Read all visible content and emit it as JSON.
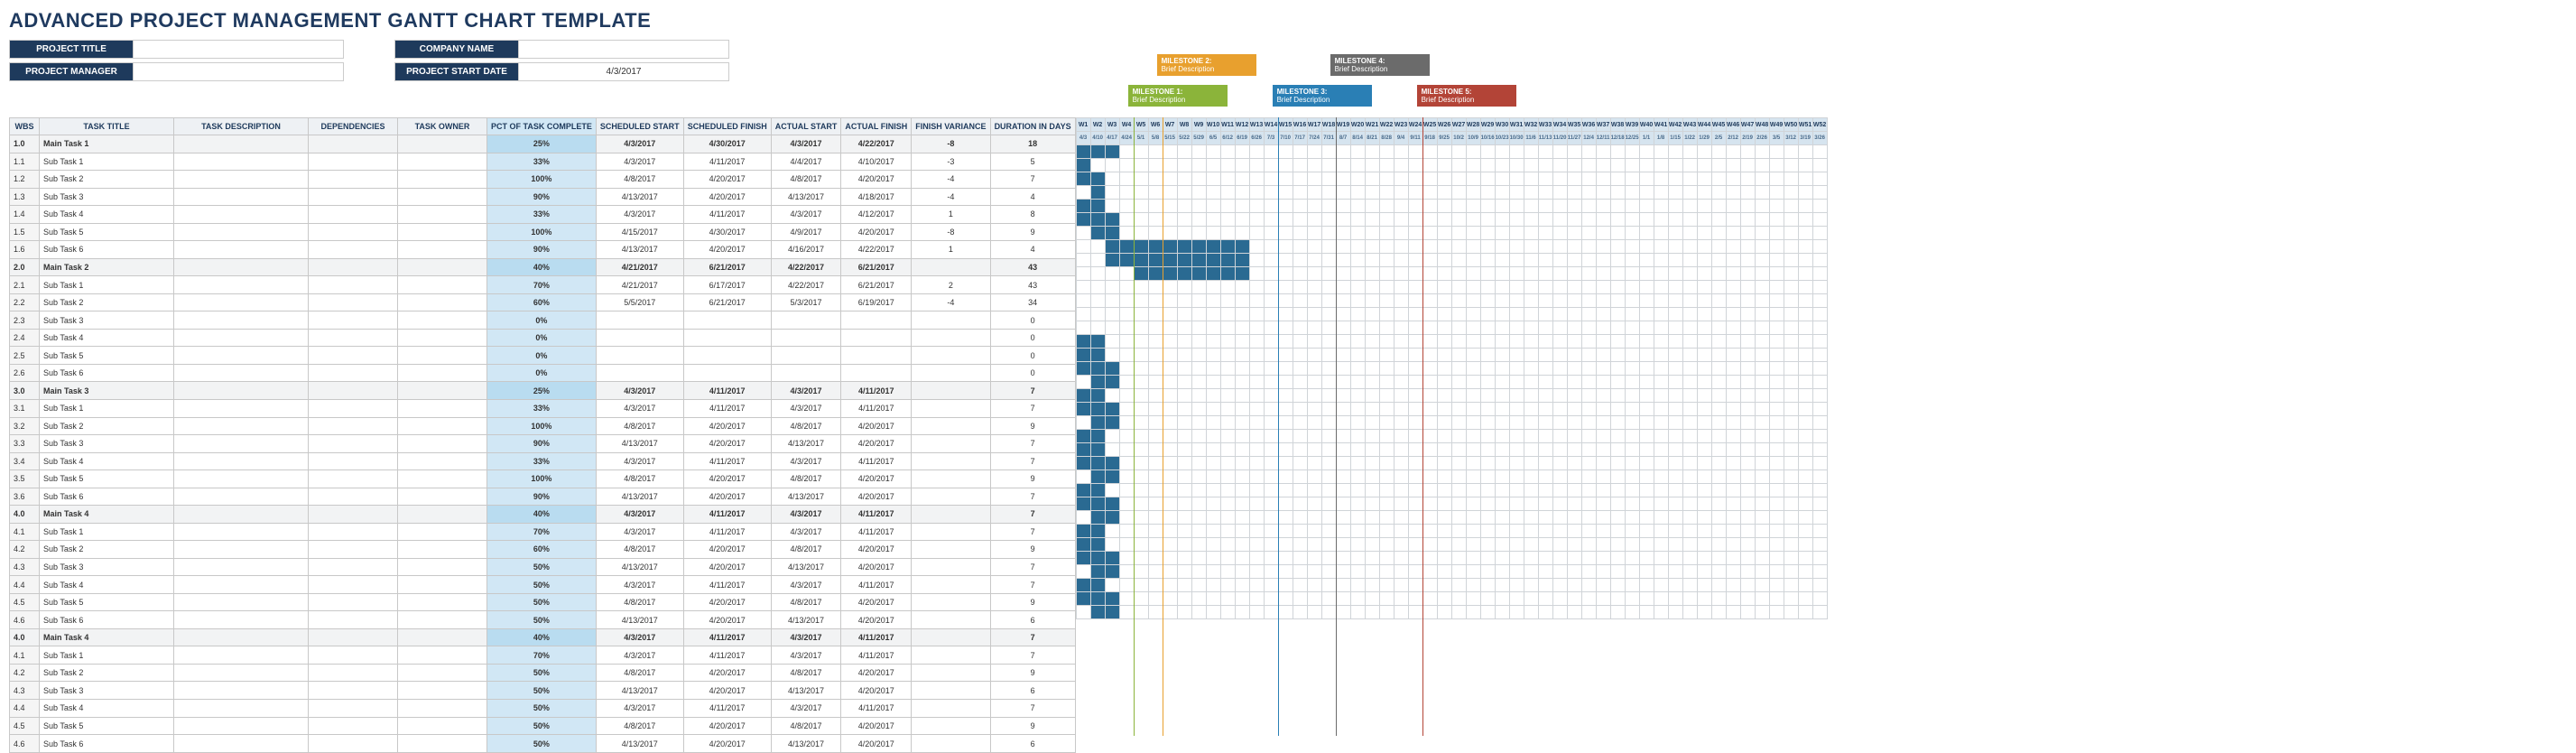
{
  "title": "ADVANCED PROJECT MANAGEMENT GANTT CHART TEMPLATE",
  "fields": {
    "projectTitle": {
      "label": "PROJECT TITLE",
      "value": ""
    },
    "projectManager": {
      "label": "PROJECT MANAGER",
      "value": ""
    },
    "companyName": {
      "label": "COMPANY NAME",
      "value": ""
    },
    "projectStartDate": {
      "label": "PROJECT START DATE",
      "value": "4/3/2017"
    }
  },
  "columns": {
    "wbs": "WBS",
    "taskTitle": "TASK TITLE",
    "taskDesc": "TASK DESCRIPTION",
    "deps": "DEPENDENCIES",
    "owner": "TASK OWNER",
    "pct": "PCT OF TASK COMPLETE",
    "schStart": "SCHEDULED START",
    "schFinish": "SCHEDULED FINISH",
    "actStart": "ACTUAL START",
    "actFinish": "ACTUAL FINISH",
    "variance": "FINISH VARIANCE",
    "duration": "DURATION IN DAYS"
  },
  "milestones": [
    {
      "id": 1,
      "title": "MILESTONE 1:",
      "sub": "Brief Description",
      "week": 5,
      "cls": "ms1"
    },
    {
      "id": 2,
      "title": "MILESTONE 2:",
      "sub": "Brief Description",
      "week": 7,
      "cls": "ms2",
      "offset": -34
    },
    {
      "id": 3,
      "title": "MILESTONE 3:",
      "sub": "Brief Description",
      "week": 15,
      "cls": "ms3"
    },
    {
      "id": 4,
      "title": "MILESTONE 4:",
      "sub": "Brief Description",
      "week": 19,
      "cls": "ms4",
      "offset": -34
    },
    {
      "id": 5,
      "title": "MILESTONE 5:",
      "sub": "Brief Description",
      "week": 25,
      "cls": "ms5"
    }
  ],
  "weeks": [
    "4/3",
    "4/10",
    "4/17",
    "4/24",
    "5/1",
    "5/8",
    "5/15",
    "5/22",
    "5/29",
    "6/5",
    "6/12",
    "6/19",
    "6/26",
    "7/3",
    "7/10",
    "7/17",
    "7/24",
    "7/31",
    "8/7",
    "8/14",
    "8/21",
    "8/28",
    "9/4",
    "9/11",
    "9/18",
    "9/25",
    "10/2",
    "10/9",
    "10/16",
    "10/23",
    "10/30",
    "11/6",
    "11/13",
    "11/20",
    "11/27",
    "12/4",
    "12/11",
    "12/18",
    "12/25",
    "1/1",
    "1/8",
    "1/15",
    "1/22",
    "1/29",
    "2/5",
    "2/12",
    "2/19",
    "2/26",
    "3/5",
    "3/12",
    "3/19",
    "3/26"
  ],
  "rows": [
    {
      "wbs": "1.0",
      "title": "Main Task 1",
      "main": true,
      "pct": "25%",
      "ss": "4/3/2017",
      "sf": "4/30/2017",
      "as": "4/3/2017",
      "af": "4/22/2017",
      "var": "-8",
      "dur": "18",
      "bar": [
        1,
        3
      ]
    },
    {
      "wbs": "1.1",
      "title": "Sub Task 1",
      "pct": "33%",
      "ss": "4/3/2017",
      "sf": "4/11/2017",
      "as": "4/4/2017",
      "af": "4/10/2017",
      "var": "-3",
      "dur": "5",
      "bar": [
        1,
        1
      ]
    },
    {
      "wbs": "1.2",
      "title": "Sub Task 2",
      "pct": "100%",
      "ss": "4/8/2017",
      "sf": "4/20/2017",
      "as": "4/8/2017",
      "af": "4/20/2017",
      "var": "-4",
      "dur": "7",
      "bar": [
        1,
        2
      ]
    },
    {
      "wbs": "1.3",
      "title": "Sub Task 3",
      "pct": "90%",
      "ss": "4/13/2017",
      "sf": "4/20/2017",
      "as": "4/13/2017",
      "af": "4/18/2017",
      "var": "-4",
      "dur": "4",
      "bar": [
        2,
        2
      ]
    },
    {
      "wbs": "1.4",
      "title": "Sub Task 4",
      "pct": "33%",
      "ss": "4/3/2017",
      "sf": "4/11/2017",
      "as": "4/3/2017",
      "af": "4/12/2017",
      "var": "1",
      "dur": "8",
      "bar": [
        1,
        2
      ]
    },
    {
      "wbs": "1.5",
      "title": "Sub Task 5",
      "pct": "100%",
      "ss": "4/15/2017",
      "sf": "4/30/2017",
      "as": "4/9/2017",
      "af": "4/20/2017",
      "var": "-8",
      "dur": "9",
      "bar": [
        1,
        3
      ]
    },
    {
      "wbs": "1.6",
      "title": "Sub Task 6",
      "pct": "90%",
      "ss": "4/13/2017",
      "sf": "4/20/2017",
      "as": "4/16/2017",
      "af": "4/22/2017",
      "var": "1",
      "dur": "4",
      "bar": [
        2,
        3
      ]
    },
    {
      "wbs": "2.0",
      "title": "Main Task 2",
      "main": true,
      "pct": "40%",
      "ss": "4/21/2017",
      "sf": "6/21/2017",
      "as": "4/22/2017",
      "af": "6/21/2017",
      "var": "",
      "dur": "43",
      "bar": [
        3,
        12
      ]
    },
    {
      "wbs": "2.1",
      "title": "Sub Task 1",
      "pct": "70%",
      "ss": "4/21/2017",
      "sf": "6/17/2017",
      "as": "4/22/2017",
      "af": "6/21/2017",
      "var": "2",
      "dur": "43",
      "bar": [
        3,
        12
      ]
    },
    {
      "wbs": "2.2",
      "title": "Sub Task 2",
      "pct": "60%",
      "ss": "5/5/2017",
      "sf": "6/21/2017",
      "as": "5/3/2017",
      "af": "6/19/2017",
      "var": "-4",
      "dur": "34",
      "bar": [
        5,
        12
      ]
    },
    {
      "wbs": "2.3",
      "title": "Sub Task 3",
      "pct": "0%",
      "ss": "",
      "sf": "",
      "as": "",
      "af": "",
      "var": "",
      "dur": "0",
      "bar": null
    },
    {
      "wbs": "2.4",
      "title": "Sub Task 4",
      "pct": "0%",
      "ss": "",
      "sf": "",
      "as": "",
      "af": "",
      "var": "",
      "dur": "0",
      "bar": null
    },
    {
      "wbs": "2.5",
      "title": "Sub Task 5",
      "pct": "0%",
      "ss": "",
      "sf": "",
      "as": "",
      "af": "",
      "var": "",
      "dur": "0",
      "bar": null
    },
    {
      "wbs": "2.6",
      "title": "Sub Task 6",
      "pct": "0%",
      "ss": "",
      "sf": "",
      "as": "",
      "af": "",
      "var": "",
      "dur": "0",
      "bar": null
    },
    {
      "wbs": "3.0",
      "title": "Main Task 3",
      "main": true,
      "pct": "25%",
      "ss": "4/3/2017",
      "sf": "4/11/2017",
      "as": "4/3/2017",
      "af": "4/11/2017",
      "var": "",
      "dur": "7",
      "bar": [
        1,
        2
      ]
    },
    {
      "wbs": "3.1",
      "title": "Sub Task 1",
      "pct": "33%",
      "ss": "4/3/2017",
      "sf": "4/11/2017",
      "as": "4/3/2017",
      "af": "4/11/2017",
      "var": "",
      "dur": "7",
      "bar": [
        1,
        2
      ]
    },
    {
      "wbs": "3.2",
      "title": "Sub Task 2",
      "pct": "100%",
      "ss": "4/8/2017",
      "sf": "4/20/2017",
      "as": "4/8/2017",
      "af": "4/20/2017",
      "var": "",
      "dur": "9",
      "bar": [
        1,
        3
      ]
    },
    {
      "wbs": "3.3",
      "title": "Sub Task 3",
      "pct": "90%",
      "ss": "4/13/2017",
      "sf": "4/20/2017",
      "as": "4/13/2017",
      "af": "4/20/2017",
      "var": "",
      "dur": "7",
      "bar": [
        2,
        3
      ]
    },
    {
      "wbs": "3.4",
      "title": "Sub Task 4",
      "pct": "33%",
      "ss": "4/3/2017",
      "sf": "4/11/2017",
      "as": "4/3/2017",
      "af": "4/11/2017",
      "var": "",
      "dur": "7",
      "bar": [
        1,
        2
      ]
    },
    {
      "wbs": "3.5",
      "title": "Sub Task 5",
      "pct": "100%",
      "ss": "4/8/2017",
      "sf": "4/20/2017",
      "as": "4/8/2017",
      "af": "4/20/2017",
      "var": "",
      "dur": "9",
      "bar": [
        1,
        3
      ]
    },
    {
      "wbs": "3.6",
      "title": "Sub Task 6",
      "pct": "90%",
      "ss": "4/13/2017",
      "sf": "4/20/2017",
      "as": "4/13/2017",
      "af": "4/20/2017",
      "var": "",
      "dur": "7",
      "bar": [
        2,
        3
      ]
    },
    {
      "wbs": "4.0",
      "title": "Main Task 4",
      "main": true,
      "pct": "40%",
      "ss": "4/3/2017",
      "sf": "4/11/2017",
      "as": "4/3/2017",
      "af": "4/11/2017",
      "var": "",
      "dur": "7",
      "bar": [
        1,
        2
      ]
    },
    {
      "wbs": "4.1",
      "title": "Sub Task 1",
      "pct": "70%",
      "ss": "4/3/2017",
      "sf": "4/11/2017",
      "as": "4/3/2017",
      "af": "4/11/2017",
      "var": "",
      "dur": "7",
      "bar": [
        1,
        2
      ]
    },
    {
      "wbs": "4.2",
      "title": "Sub Task 2",
      "pct": "60%",
      "ss": "4/8/2017",
      "sf": "4/20/2017",
      "as": "4/8/2017",
      "af": "4/20/2017",
      "var": "",
      "dur": "9",
      "bar": [
        1,
        3
      ]
    },
    {
      "wbs": "4.3",
      "title": "Sub Task 3",
      "pct": "50%",
      "ss": "4/13/2017",
      "sf": "4/20/2017",
      "as": "4/13/2017",
      "af": "4/20/2017",
      "var": "",
      "dur": "7",
      "bar": [
        2,
        3
      ]
    },
    {
      "wbs": "4.4",
      "title": "Sub Task 4",
      "pct": "50%",
      "ss": "4/3/2017",
      "sf": "4/11/2017",
      "as": "4/3/2017",
      "af": "4/11/2017",
      "var": "",
      "dur": "7",
      "bar": [
        1,
        2
      ]
    },
    {
      "wbs": "4.5",
      "title": "Sub Task 5",
      "pct": "50%",
      "ss": "4/8/2017",
      "sf": "4/20/2017",
      "as": "4/8/2017",
      "af": "4/20/2017",
      "var": "",
      "dur": "9",
      "bar": [
        1,
        3
      ]
    },
    {
      "wbs": "4.6",
      "title": "Sub Task 6",
      "pct": "50%",
      "ss": "4/13/2017",
      "sf": "4/20/2017",
      "as": "4/13/2017",
      "af": "4/20/2017",
      "var": "",
      "dur": "6",
      "bar": [
        2,
        3
      ]
    },
    {
      "wbs": "4.0",
      "title": "Main Task 4",
      "main": true,
      "pct": "40%",
      "ss": "4/3/2017",
      "sf": "4/11/2017",
      "as": "4/3/2017",
      "af": "4/11/2017",
      "var": "",
      "dur": "7",
      "bar": [
        1,
        2
      ]
    },
    {
      "wbs": "4.1",
      "title": "Sub Task 1",
      "pct": "70%",
      "ss": "4/3/2017",
      "sf": "4/11/2017",
      "as": "4/3/2017",
      "af": "4/11/2017",
      "var": "",
      "dur": "7",
      "bar": [
        1,
        2
      ]
    },
    {
      "wbs": "4.2",
      "title": "Sub Task 2",
      "pct": "50%",
      "ss": "4/8/2017",
      "sf": "4/20/2017",
      "as": "4/8/2017",
      "af": "4/20/2017",
      "var": "",
      "dur": "9",
      "bar": [
        1,
        3
      ]
    },
    {
      "wbs": "4.3",
      "title": "Sub Task 3",
      "pct": "50%",
      "ss": "4/13/2017",
      "sf": "4/20/2017",
      "as": "4/13/2017",
      "af": "4/20/2017",
      "var": "",
      "dur": "6",
      "bar": [
        2,
        3
      ]
    },
    {
      "wbs": "4.4",
      "title": "Sub Task 4",
      "pct": "50%",
      "ss": "4/3/2017",
      "sf": "4/11/2017",
      "as": "4/3/2017",
      "af": "4/11/2017",
      "var": "",
      "dur": "7",
      "bar": [
        1,
        2
      ]
    },
    {
      "wbs": "4.5",
      "title": "Sub Task 5",
      "pct": "50%",
      "ss": "4/8/2017",
      "sf": "4/20/2017",
      "as": "4/8/2017",
      "af": "4/20/2017",
      "var": "",
      "dur": "9",
      "bar": [
        1,
        3
      ]
    },
    {
      "wbs": "4.6",
      "title": "Sub Task 6",
      "pct": "50%",
      "ss": "4/13/2017",
      "sf": "4/20/2017",
      "as": "4/13/2017",
      "af": "4/20/2017",
      "var": "",
      "dur": "6",
      "bar": [
        2,
        3
      ]
    }
  ],
  "chart_data": {
    "type": "gantt",
    "title": "Advanced Project Management Gantt Chart",
    "x_unit": "weeks",
    "x_start": "2017-04-03",
    "x_end": "2018-03-26",
    "tasks": [
      {
        "name": "Main Task 1",
        "start": "2017-04-03",
        "end": "2017-04-22",
        "pct": 25
      },
      {
        "name": "Sub Task 1.1",
        "start": "2017-04-04",
        "end": "2017-04-10",
        "pct": 33
      },
      {
        "name": "Sub Task 1.2",
        "start": "2017-04-08",
        "end": "2017-04-20",
        "pct": 100
      },
      {
        "name": "Sub Task 1.3",
        "start": "2017-04-13",
        "end": "2017-04-18",
        "pct": 90
      },
      {
        "name": "Sub Task 1.4",
        "start": "2017-04-03",
        "end": "2017-04-12",
        "pct": 33
      },
      {
        "name": "Sub Task 1.5",
        "start": "2017-04-09",
        "end": "2017-04-20",
        "pct": 100
      },
      {
        "name": "Sub Task 1.6",
        "start": "2017-04-16",
        "end": "2017-04-22",
        "pct": 90
      },
      {
        "name": "Main Task 2",
        "start": "2017-04-22",
        "end": "2017-06-21",
        "pct": 40
      },
      {
        "name": "Sub Task 2.1",
        "start": "2017-04-22",
        "end": "2017-06-21",
        "pct": 70
      },
      {
        "name": "Sub Task 2.2",
        "start": "2017-05-03",
        "end": "2017-06-19",
        "pct": 60
      },
      {
        "name": "Main Task 3",
        "start": "2017-04-03",
        "end": "2017-04-11",
        "pct": 25
      },
      {
        "name": "Main Task 4",
        "start": "2017-04-03",
        "end": "2017-04-11",
        "pct": 40
      }
    ],
    "milestones": [
      {
        "name": "Milestone 1",
        "week": 5
      },
      {
        "name": "Milestone 2",
        "week": 7
      },
      {
        "name": "Milestone 3",
        "week": 15
      },
      {
        "name": "Milestone 4",
        "week": 19
      },
      {
        "name": "Milestone 5",
        "week": 25
      }
    ]
  }
}
